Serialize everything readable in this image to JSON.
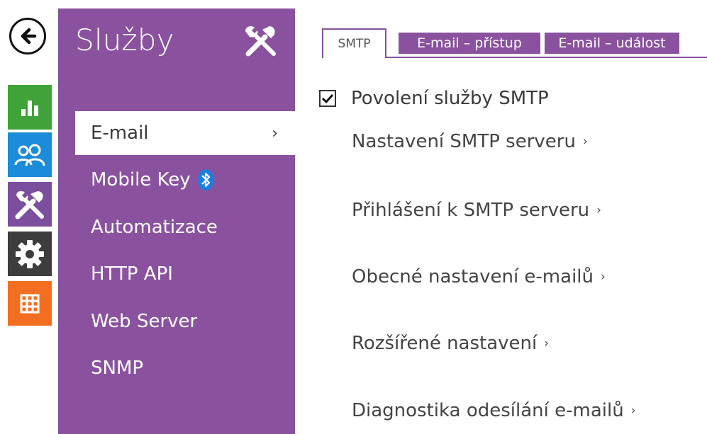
{
  "rail": {
    "back_icon": "back-arrow-icon",
    "items": [
      {
        "icon": "status-chart-icon",
        "color": "#3fa33a"
      },
      {
        "icon": "directory-users-icon",
        "color": "#1d8cd8"
      },
      {
        "icon": "services-tools-icon",
        "color": "#7b4f9e"
      },
      {
        "icon": "hardware-gear-icon",
        "color": "#3d3d3d"
      },
      {
        "icon": "system-grid-icon",
        "color": "#f26f21"
      }
    ]
  },
  "menu": {
    "title": "Služby",
    "accent": "#8a529e",
    "items": [
      {
        "label": "E-mail",
        "active": true,
        "chevron": "›"
      },
      {
        "label": "Mobile Key",
        "badge": "bluetooth-icon"
      },
      {
        "label": "Automatizace"
      },
      {
        "label": "HTTP API"
      },
      {
        "label": "Web Server"
      },
      {
        "label": "SNMP"
      }
    ]
  },
  "tabs": [
    {
      "label": "SMTP",
      "active": true
    },
    {
      "label": "E-mail – přístup"
    },
    {
      "label": "E-mail – událost"
    }
  ],
  "content": {
    "enable_label": "Povolení služby SMTP",
    "enable_checked": true,
    "sections": [
      {
        "label": "Nastavení SMTP serveru",
        "arrow": "›"
      },
      {
        "label": "Přihlášení k SMTP serveru",
        "arrow": "›"
      },
      {
        "label": "Obecné nastavení e-mailů",
        "arrow": "›"
      },
      {
        "label": "Rozšířené nastavení",
        "arrow": "›"
      },
      {
        "label": "Diagnostika odesílání e-mailů",
        "arrow": "›"
      }
    ]
  }
}
